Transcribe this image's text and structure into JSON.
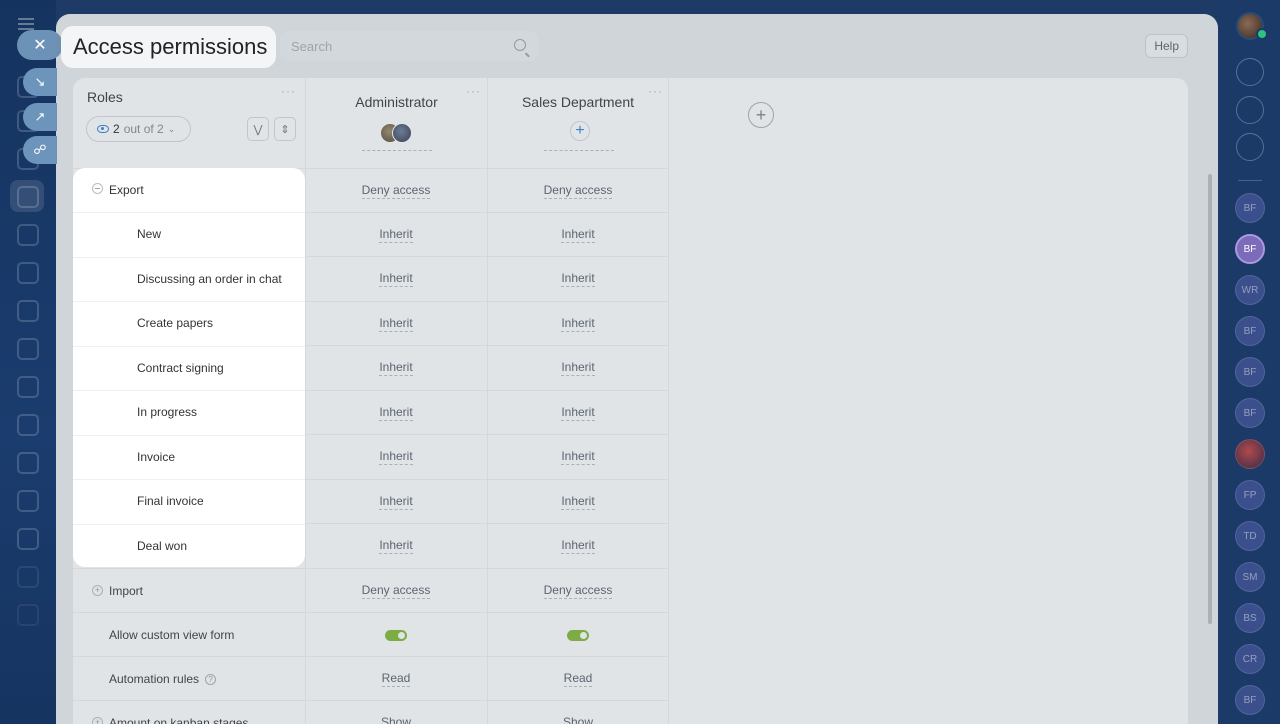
{
  "page": {
    "title": "Access permissions",
    "search_placeholder": "Search",
    "help_label": "Help"
  },
  "roles": {
    "label": "Roles",
    "filter_count": "2",
    "filter_text": "out of 2"
  },
  "columns": [
    {
      "name": "Administrator"
    },
    {
      "name": "Sales Department"
    }
  ],
  "rows": [
    {
      "label": "Export",
      "type": "group",
      "expanded": true,
      "admin": "Deny access",
      "sales": "Deny access"
    },
    {
      "label": "New",
      "type": "sub",
      "admin": "Inherit",
      "sales": "Inherit"
    },
    {
      "label": "Discussing an order in chat",
      "type": "sub",
      "admin": "Inherit",
      "sales": "Inherit"
    },
    {
      "label": "Create papers",
      "type": "sub",
      "admin": "Inherit",
      "sales": "Inherit"
    },
    {
      "label": "Contract signing",
      "type": "sub",
      "admin": "Inherit",
      "sales": "Inherit"
    },
    {
      "label": "In progress",
      "type": "sub",
      "admin": "Inherit",
      "sales": "Inherit"
    },
    {
      "label": "Invoice",
      "type": "sub",
      "admin": "Inherit",
      "sales": "Inherit"
    },
    {
      "label": "Final invoice",
      "type": "sub",
      "admin": "Inherit",
      "sales": "Inherit"
    },
    {
      "label": "Deal won",
      "type": "sub",
      "admin": "Inherit",
      "sales": "Inherit"
    },
    {
      "label": "Import",
      "type": "group",
      "expanded": false,
      "admin": "Deny access",
      "sales": "Deny access"
    },
    {
      "label": "Allow custom view form",
      "type": "toggle",
      "admin": "on",
      "sales": "on"
    },
    {
      "label": "Automation rules",
      "type": "help",
      "admin": "Read",
      "sales": "Read"
    },
    {
      "label": "Amount on kanban stages",
      "type": "group-partial",
      "admin": "Show",
      "sales": "Show"
    }
  ],
  "right_sidebar": {
    "avatars": [
      "BF",
      "BF",
      "WR",
      "BF",
      "BF",
      "BF",
      "",
      "FP",
      "TD",
      "SM",
      "BS",
      "CR",
      "BF"
    ]
  },
  "colors": {
    "toggle_on": "#7fb830",
    "accent": "#2f7fd6"
  }
}
